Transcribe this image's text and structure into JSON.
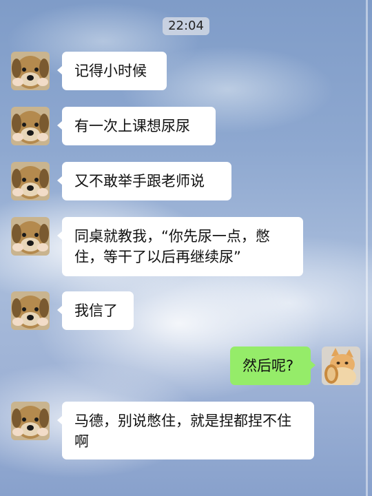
{
  "chat": {
    "time_divider": "22:04",
    "messages": [
      {
        "sender": "friend",
        "text": "记得小时候"
      },
      {
        "sender": "friend",
        "text": "有一次上课想尿尿"
      },
      {
        "sender": "friend",
        "text": "又不敢举手跟老师说"
      },
      {
        "sender": "friend",
        "text": "同桌就教我，“你先尿一点，憋住，等干了以后再继续尿”"
      },
      {
        "sender": "friend",
        "text": "我信了"
      },
      {
        "sender": "me",
        "text": "然后呢?"
      },
      {
        "sender": "friend",
        "text": "马德，别说憋住，就是捏都捏不住啊"
      }
    ]
  },
  "avatars": {
    "friend": "dog-avatar",
    "me": "cat-avatar"
  },
  "colors": {
    "incoming_bubble": "#ffffff",
    "outgoing_bubble": "#95ec69"
  }
}
